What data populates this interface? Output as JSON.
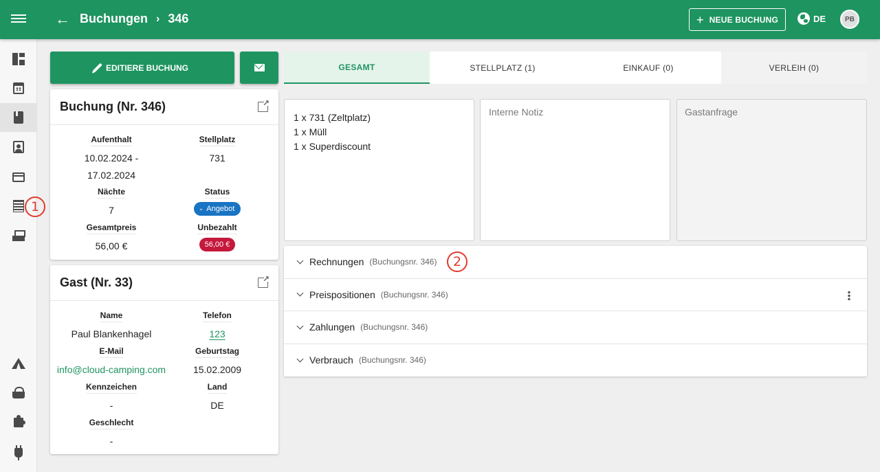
{
  "header": {
    "breadcrumb_root": "Buchungen",
    "breadcrumb_current": "346",
    "new_booking_label": "NEUE BUCHUNG",
    "language": "DE",
    "avatar_initials": "PB"
  },
  "sidebar": {
    "items": [
      {
        "name": "dashboard",
        "icon": "dashboard-icon"
      },
      {
        "name": "calendar",
        "icon": "calendar-icon"
      },
      {
        "name": "bookings",
        "icon": "book-icon",
        "active": true
      },
      {
        "name": "guests",
        "icon": "contact-icon"
      },
      {
        "name": "payments",
        "icon": "credit-card-icon"
      },
      {
        "name": "lists",
        "icon": "list-icon"
      },
      {
        "name": "register",
        "icon": "cash-register-icon"
      },
      {
        "name": "camping",
        "icon": "tent-icon"
      },
      {
        "name": "shop",
        "icon": "basket-icon"
      },
      {
        "name": "extensions",
        "icon": "puzzle-icon"
      },
      {
        "name": "power",
        "icon": "plug-icon"
      }
    ]
  },
  "markers": {
    "one": "1",
    "two": "2"
  },
  "actions": {
    "edit_label": "EDITIERE BUCHUNG"
  },
  "booking_card": {
    "title": "Buchung (Nr. 346)",
    "stay_label": "Aufenthalt",
    "stay_value": "10.02.2024 - 17.02.2024",
    "pitch_label": "Stellplatz",
    "pitch_value": "731",
    "nights_label": "Nächte",
    "nights_value": "7",
    "status_label": "Status",
    "status_value": "Angebot",
    "total_label": "Gesamtpreis",
    "total_value": "56,00 €",
    "unpaid_label": "Unbezahlt",
    "unpaid_value": "56,00 €"
  },
  "guest_card": {
    "title": "Gast (Nr. 33)",
    "name_label": "Name",
    "name_value": "Paul Blankenhagel",
    "phone_label": "Telefon",
    "phone_value": "123",
    "email_label": "E-Mail",
    "email_value": "info@cloud-camping.com",
    "birthday_label": "Geburtstag",
    "birthday_value": "15.02.2009",
    "plate_label": "Kennzeichen",
    "plate_value": "-",
    "country_label": "Land",
    "country_value": "DE",
    "gender_label": "Geschlecht",
    "gender_value": "-"
  },
  "tabs": [
    {
      "label": "GESAMT",
      "active": true
    },
    {
      "label": "STELLPLATZ (1)"
    },
    {
      "label": "EINKAUF (0)"
    },
    {
      "label": "VERLEIH (0)"
    }
  ],
  "items_box": {
    "lines": [
      "1 x 731 (Zeltplatz)",
      "1 x Müll",
      "1 x Superdiscount"
    ]
  },
  "notes": {
    "internal_placeholder": "Interne Notiz",
    "guest_request_placeholder": "Gastanfrage"
  },
  "accordion": [
    {
      "title": "Rechnungen",
      "sub": "(Buchungsnr. 346)"
    },
    {
      "title": "Preispositionen",
      "sub": "(Buchungsnr. 346)"
    },
    {
      "title": "Zahlungen",
      "sub": "(Buchungsnr. 346)"
    },
    {
      "title": "Verbrauch",
      "sub": "(Buchungsnr. 346)"
    }
  ],
  "colors": {
    "primary": "#1e9460",
    "status_blue": "#1974c4",
    "unpaid_red": "#c4183c",
    "marker_red": "#e23a2e"
  }
}
